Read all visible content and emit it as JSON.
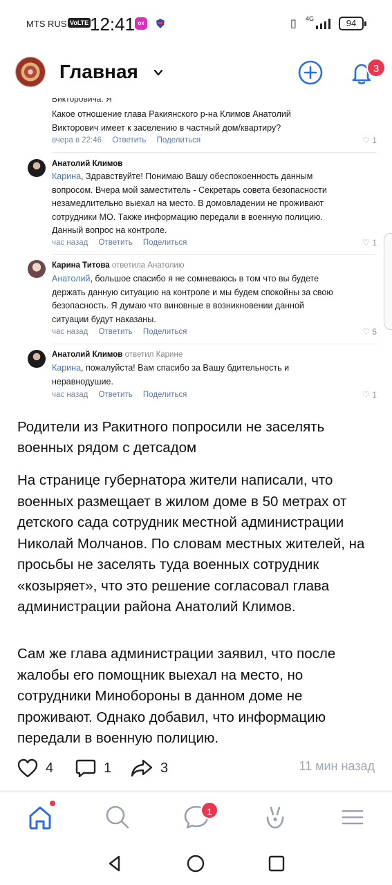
{
  "status_bar": {
    "carrier": "MTS RUS",
    "volte": "VoLTE",
    "time": "12:41",
    "network": "4G",
    "battery": "94"
  },
  "header": {
    "title": "Главная",
    "notification_count": "3"
  },
  "comments_screenshot": {
    "partial_top": "Викторовича. Я",
    "question": {
      "text_line1": "Какое отношение глава Ракиянского р-на Климов Анатолий",
      "text_line2": "Викторович имеет к заселению в частный дом/квартиру?",
      "time": "вчера в 22:46",
      "reply": "Ответить",
      "share": "Поделиться",
      "likes": "1"
    },
    "items": [
      {
        "author": "Анатолий Климов",
        "reply_to": "",
        "mention": "Карина",
        "lines": [
          ", Здравствуйте! Понимаю Вашу обеспокоенность данным",
          "вопросом. Вчера мой заместитель - Секретарь совета безопасности",
          "незамедлительно выехал на место. В домовладении не проживают",
          "сотрудники МО. Также информацию передали в военную полицию.",
          "Данный вопрос на контроле."
        ],
        "time": "час назад",
        "reply": "Ответить",
        "share": "Поделиться",
        "likes": "1"
      },
      {
        "author": "Карина Титова",
        "reply_to": "ответила Анатолию",
        "mention": "Анатолий",
        "lines": [
          ", большое спасибо я не сомневаюсь в том что вы будете",
          "держать данную ситуацию на контроле и мы будем спокойны за свою",
          "безопасность. Я думаю что виновные в возникновении данной",
          "ситуации будут наказаны."
        ],
        "time": "час назад",
        "reply": "Ответить",
        "share": "Поделиться",
        "likes": "5"
      },
      {
        "author": "Анатолий Климов",
        "reply_to": "ответил Карине",
        "mention": "Карина",
        "lines": [
          ", пожалуйста! Вам спасибо за Вашу бдительность и",
          "неравнодушие."
        ],
        "time": "час назад",
        "reply": "Ответить",
        "share": "Поделиться",
        "likes": "1"
      }
    ]
  },
  "post": {
    "headline": "Родители из Ракитного попросили не заселять военных рядом с детсадом",
    "paragraph1": "На странице губернатора жители написали, что военных размещает в жилом доме в 50 метрах от детского сада сотрудник местной администрации Николай Молчанов. По словам местных жителей, на просьбы не заселять туда военных сотрудник «козыряет», что это решение согласовал глава администрации района Анатолий Климов.",
    "paragraph2": "Сам же глава администрации заявил, что после жалобы его помощник выехал на место, но сотрудники Минобороны в данном доме не проживают. Однако добавил, что информацию передали в военную полицию.",
    "likes": "4",
    "comments": "1",
    "shares": "3",
    "time_ago": "11 мин назад"
  },
  "bottom_nav": {
    "messages_badge": "1"
  },
  "colors": {
    "accent": "#2a6fdb",
    "badge": "#e8384f",
    "link": "#4a76a8"
  }
}
